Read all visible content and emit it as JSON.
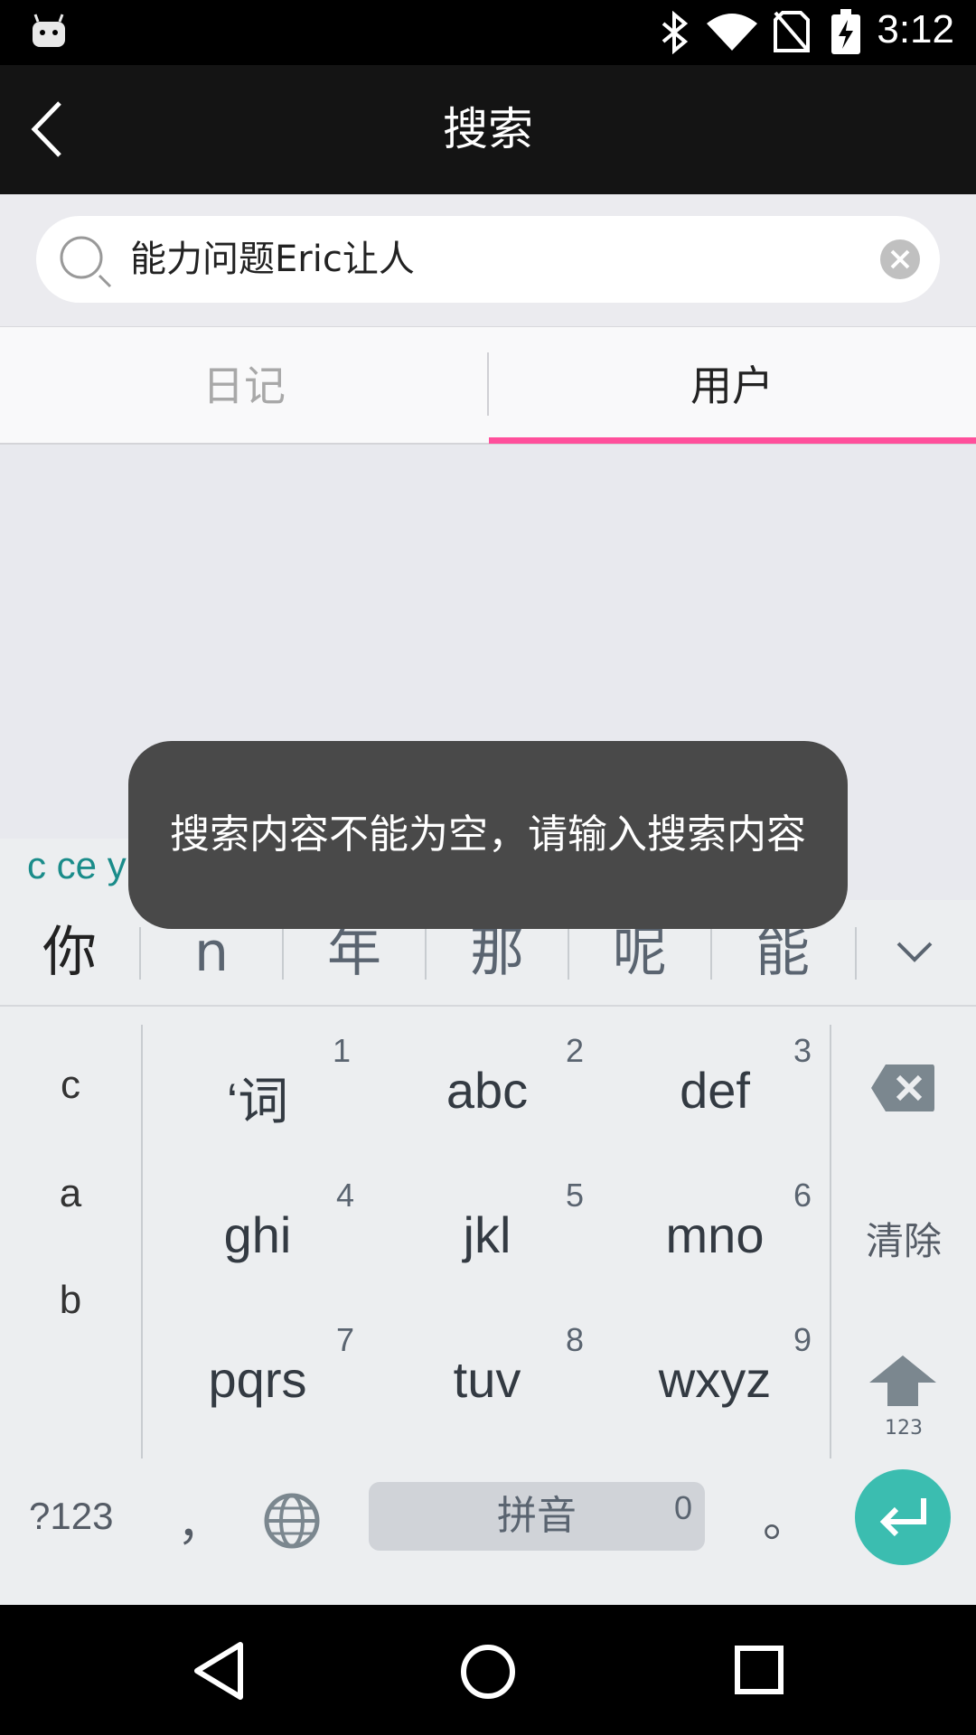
{
  "status_bar": {
    "time": "3:12"
  },
  "app_bar": {
    "title": "搜索"
  },
  "search": {
    "value": "能力问题Eric让人"
  },
  "tabs": [
    {
      "label": "日记",
      "selected": false
    },
    {
      "label": "用户",
      "selected": true
    }
  ],
  "ime": {
    "composing": "c ce yi",
    "candidates": [
      "你",
      "n",
      "年",
      "那",
      "呢",
      "能"
    ],
    "side_letters": [
      "c",
      "a",
      "b"
    ],
    "keys": [
      {
        "label": "‘词",
        "num": "1"
      },
      {
        "label": "abc",
        "num": "2"
      },
      {
        "label": "def",
        "num": "3"
      },
      {
        "label": "ghi",
        "num": "4"
      },
      {
        "label": "jkl",
        "num": "5"
      },
      {
        "label": "mno",
        "num": "6"
      },
      {
        "label": "pqrs",
        "num": "7"
      },
      {
        "label": "tuv",
        "num": "8"
      },
      {
        "label": "wxyz",
        "num": "9"
      }
    ],
    "clear_label": "清除",
    "shift_sub": "123",
    "sym_label": "?123",
    "comma": "，",
    "space_label": "拼音",
    "space_num": "0",
    "period": "。"
  },
  "toast": {
    "message": "搜索内容不能为空，请输入搜索内容"
  },
  "colors": {
    "accent": "#ff4f9b",
    "enter": "#3bbdb0",
    "toast_bg": "#494949"
  }
}
